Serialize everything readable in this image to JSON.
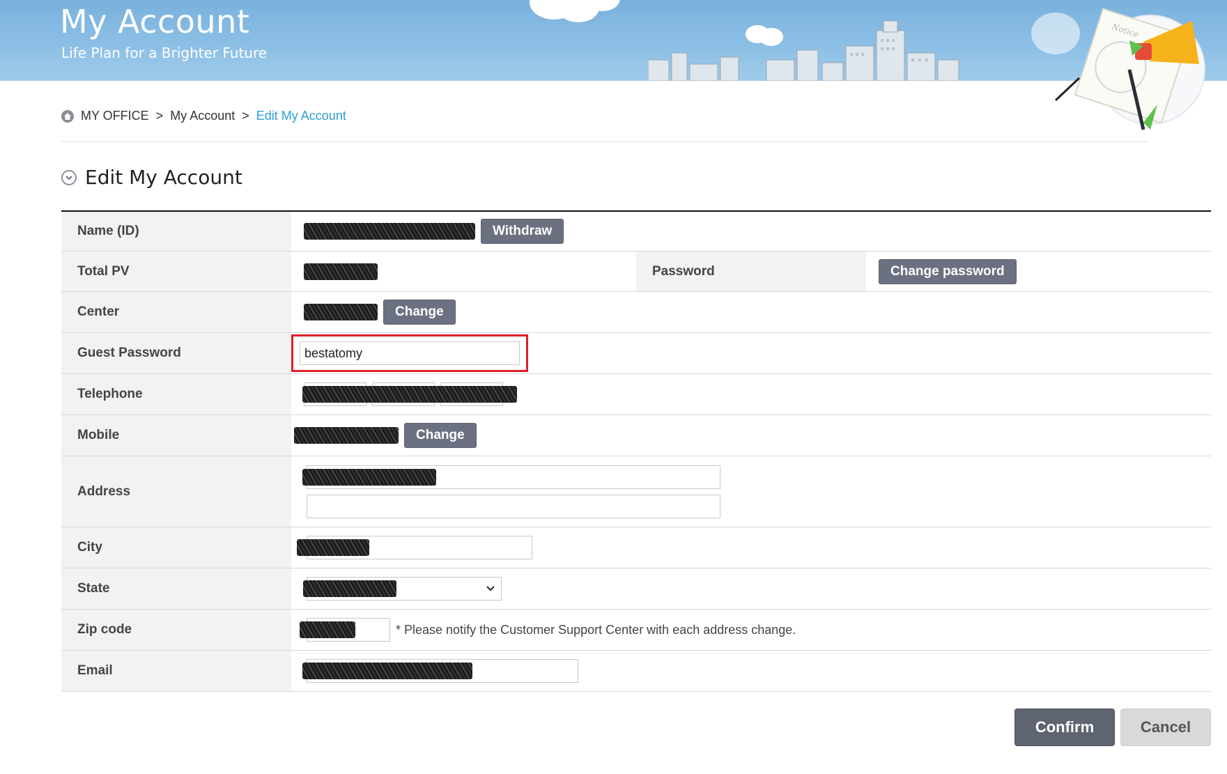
{
  "banner": {
    "title": "My Account",
    "subtitle": "Life Plan for a Brighter Future"
  },
  "breadcrumb": {
    "items": [
      "MY OFFICE",
      "My Account",
      "Edit My Account"
    ],
    "separator": ">"
  },
  "section": {
    "title": "Edit My Account"
  },
  "form": {
    "name_label": "Name (ID)",
    "withdraw_button": "Withdraw",
    "total_pv_label": "Total PV",
    "password_label": "Password",
    "change_password_button": "Change password",
    "center_label": "Center",
    "center_change_button": "Change",
    "guest_password_label": "Guest Password",
    "guest_password_value": "bestatomy",
    "telephone_label": "Telephone",
    "mobile_label": "Mobile",
    "mobile_change_button": "Change",
    "address_label": "Address",
    "city_label": "City",
    "state_label": "State",
    "zip_label": "Zip code",
    "zip_note": "* Please notify the Customer Support Center with each address change.",
    "email_label": "Email"
  },
  "actions": {
    "confirm": "Confirm",
    "cancel": "Cancel"
  },
  "colors": {
    "accent": "#2a9fd6",
    "button": "#6b7180",
    "highlight": "#e0202a",
    "banner": "#8ec0e6"
  }
}
